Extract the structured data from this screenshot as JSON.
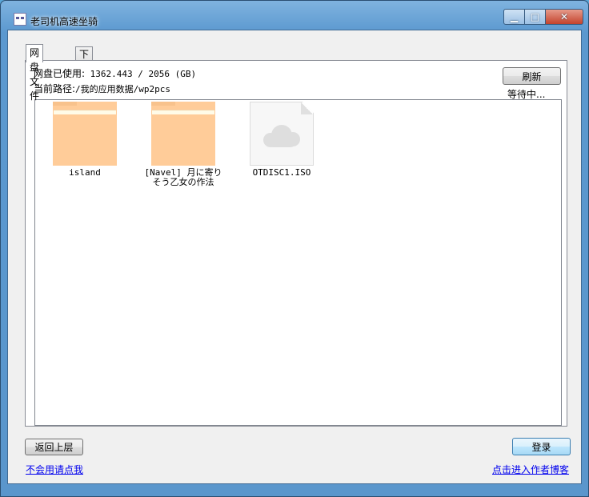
{
  "window": {
    "title": "老司机高速坐骑",
    "caption_buttons": {
      "minimize": "▁",
      "maximize": "□",
      "close": "✕"
    }
  },
  "tabs": [
    {
      "label": "网盘文件",
      "active": true
    },
    {
      "label": "下载管理",
      "active": false
    }
  ],
  "usage": {
    "label": "网盘已使用:",
    "value": "1362.443 / 2056 (GB)"
  },
  "path": {
    "label": "当前路径:",
    "value": "/我的应用数据/wp2pcs"
  },
  "refresh_button": "刷新",
  "status": "等待中...",
  "files": [
    {
      "name": "island",
      "type": "folder",
      "icon": "folder-icon"
    },
    {
      "name": "[Navel] 月に寄りそう乙女の作法",
      "type": "folder",
      "icon": "folder-icon"
    },
    {
      "name": "OTDISC1.ISO",
      "type": "file",
      "icon": "cloud-file-icon"
    }
  ],
  "back_button": "返回上层",
  "login_button": "登录",
  "links": {
    "help": "不会用请点我",
    "blog": "点击进入作者博客"
  },
  "colors": {
    "folder": "#ffcc99",
    "link": "#0000ee",
    "title_gradient_top": "#7fb3df",
    "close_button": "#c4432d"
  }
}
